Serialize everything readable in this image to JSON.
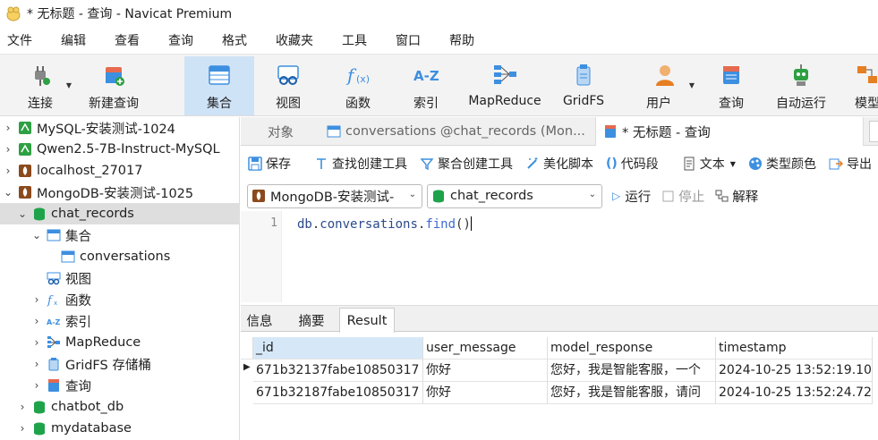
{
  "window": {
    "title": "* 无标题 - 查询 - Navicat Premium"
  },
  "menu": [
    "文件",
    "编辑",
    "查看",
    "查询",
    "格式",
    "收藏夹",
    "工具",
    "窗口",
    "帮助"
  ],
  "toolbar": {
    "connect": "连接",
    "new_query": "新建查询",
    "collection": "集合",
    "view": "视图",
    "function": "函数",
    "index": "索引",
    "mapreduce": "MapReduce",
    "gridfs": "GridFS",
    "user": "用户",
    "query": "查询",
    "automation": "自动运行",
    "model": "模型"
  },
  "sidebar": {
    "items": [
      {
        "label": "MySQL-安装测试-1024"
      },
      {
        "label": "Qwen2.5-7B-Instruct-MySQL"
      },
      {
        "label": "localhost_27017"
      },
      {
        "label": "MongoDB-安装测试-1025"
      },
      {
        "label": "chat_records"
      },
      {
        "label": "集合"
      },
      {
        "label": "conversations"
      },
      {
        "label": "视图"
      },
      {
        "label": "函数"
      },
      {
        "label": "索引"
      },
      {
        "label": "MapReduce"
      },
      {
        "label": "GridFS 存储桶"
      },
      {
        "label": "查询"
      },
      {
        "label": "chatbot_db"
      },
      {
        "label": "mydatabase"
      }
    ]
  },
  "tabs": {
    "objects": "对象",
    "conversations_tab": "conversations @chat_records (Mon...",
    "query_tab": "* 无标题 - 查询"
  },
  "query_toolbar": {
    "save": "保存",
    "find_builder": "查找创建工具",
    "aggregate_builder": "聚合创建工具",
    "beautify": "美化脚本",
    "snippet": "代码段",
    "text": "文本",
    "type_color": "类型颜色",
    "export": "导出"
  },
  "selectors": {
    "connection": "MongoDB-安装测试-",
    "database": "chat_records",
    "run": "运行",
    "stop": "停止",
    "explain": "解释"
  },
  "editor": {
    "line_number": "1",
    "code_obj": "db",
    "code_dot1": ".",
    "code_coll": "conversations",
    "code_dot2": ".",
    "code_method": "find",
    "code_parens": "()"
  },
  "result_tabs": {
    "info": "信息",
    "summary": "摘要",
    "result": "Result"
  },
  "result": {
    "columns": [
      "_id",
      "user_message",
      "model_response",
      "timestamp"
    ],
    "rows": [
      [
        "671b32137fabe10850317",
        "你好",
        "您好，我是智能客服，一个",
        "2024-10-25 13:52:19.10"
      ],
      [
        "671b32187fabe10850317",
        "你好",
        "您好，我是智能客服，请问",
        "2024-10-25 13:52:24.72"
      ]
    ]
  },
  "colors": {
    "accent": "#cfe3f7",
    "green_db": "#1fa34a",
    "mongo_brown": "#8b4a1c",
    "toolbar_bg": "#f3f3f3"
  }
}
